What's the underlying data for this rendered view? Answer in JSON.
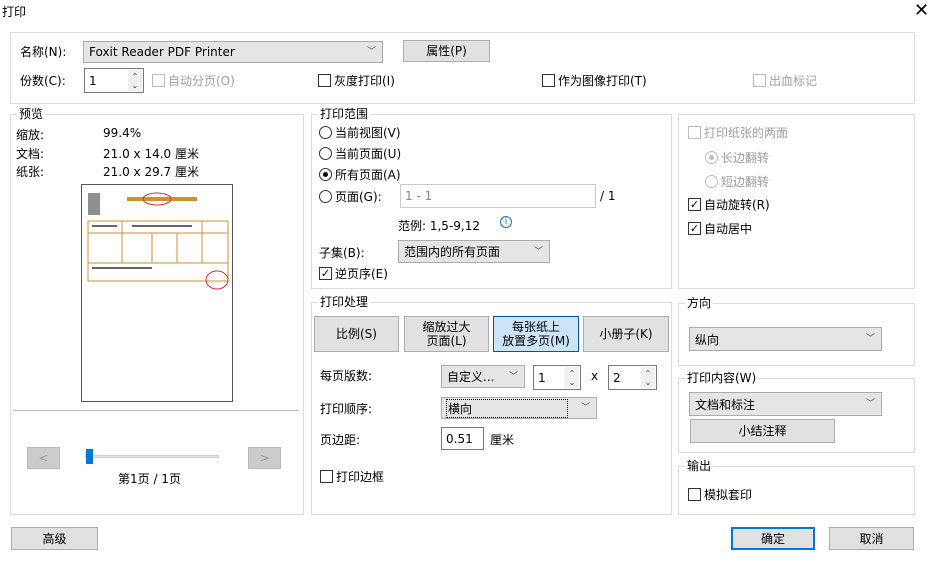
{
  "title": "打印",
  "printer": {
    "name_label": "名称(N):",
    "name_value": "Foxit Reader PDF Printer",
    "properties_button": "属性(P)",
    "copies_label": "份数(C):",
    "copies_value": "1",
    "collate": "自动分页(O)",
    "grayscale": "灰度打印(I)",
    "print_as_image": "作为图像打印(T)",
    "bleed_marks": "出血标记"
  },
  "preview": {
    "title": "预览",
    "zoom_label": "缩放:",
    "zoom_value": "99.4%",
    "doc_label": "文档:",
    "doc_value": "21.0 x 14.0 厘米",
    "paper_label": "纸张:",
    "paper_value": "21.0 x 29.7 厘米",
    "prev": "<",
    "next": ">",
    "page_indicator": "第1页 / 1页"
  },
  "range": {
    "title": "打印范围",
    "current_view": "当前视图(V)",
    "current_page": "当前页面(U)",
    "all_pages": "所有页面(A)",
    "pages": "页面(G):",
    "pages_placeholder": "1 - 1",
    "pages_total": "/ 1",
    "example": "范例: 1,5-9,12",
    "subset_label": "子集(B):",
    "subset_value": "范围内的所有页面",
    "reverse": "逆页序(E)"
  },
  "duplex": {
    "both_sides": "打印纸张的两面",
    "long_edge": "长边翻转",
    "short_edge": "短边翻转",
    "auto_rotate": "自动旋转(R)",
    "auto_center": "自动居中"
  },
  "handling": {
    "title": "打印处理",
    "tabs": [
      "比例(S)",
      "缩放过大\n页面(L)",
      "每张纸上\n放置多页(M)",
      "小册子(K)"
    ],
    "pages_per_sheet_label": "每页版数:",
    "pages_per_sheet_value": "自定义...",
    "cols": "1",
    "x": "x",
    "rows": "2",
    "order_label": "打印顺序:",
    "order_value": "横向",
    "margin_label": "页边距:",
    "margin_value": "0.51",
    "margin_unit": "厘米",
    "print_border": "打印边框"
  },
  "orientation": {
    "title": "方向",
    "value": "纵向"
  },
  "content": {
    "title": "打印内容(W)",
    "value": "文档和标注",
    "summarize_button": "小结注释"
  },
  "output": {
    "title": "输出",
    "simulate_overprint": "模拟套印"
  },
  "footer": {
    "advanced": "高级",
    "ok": "确定",
    "cancel": "取消"
  }
}
